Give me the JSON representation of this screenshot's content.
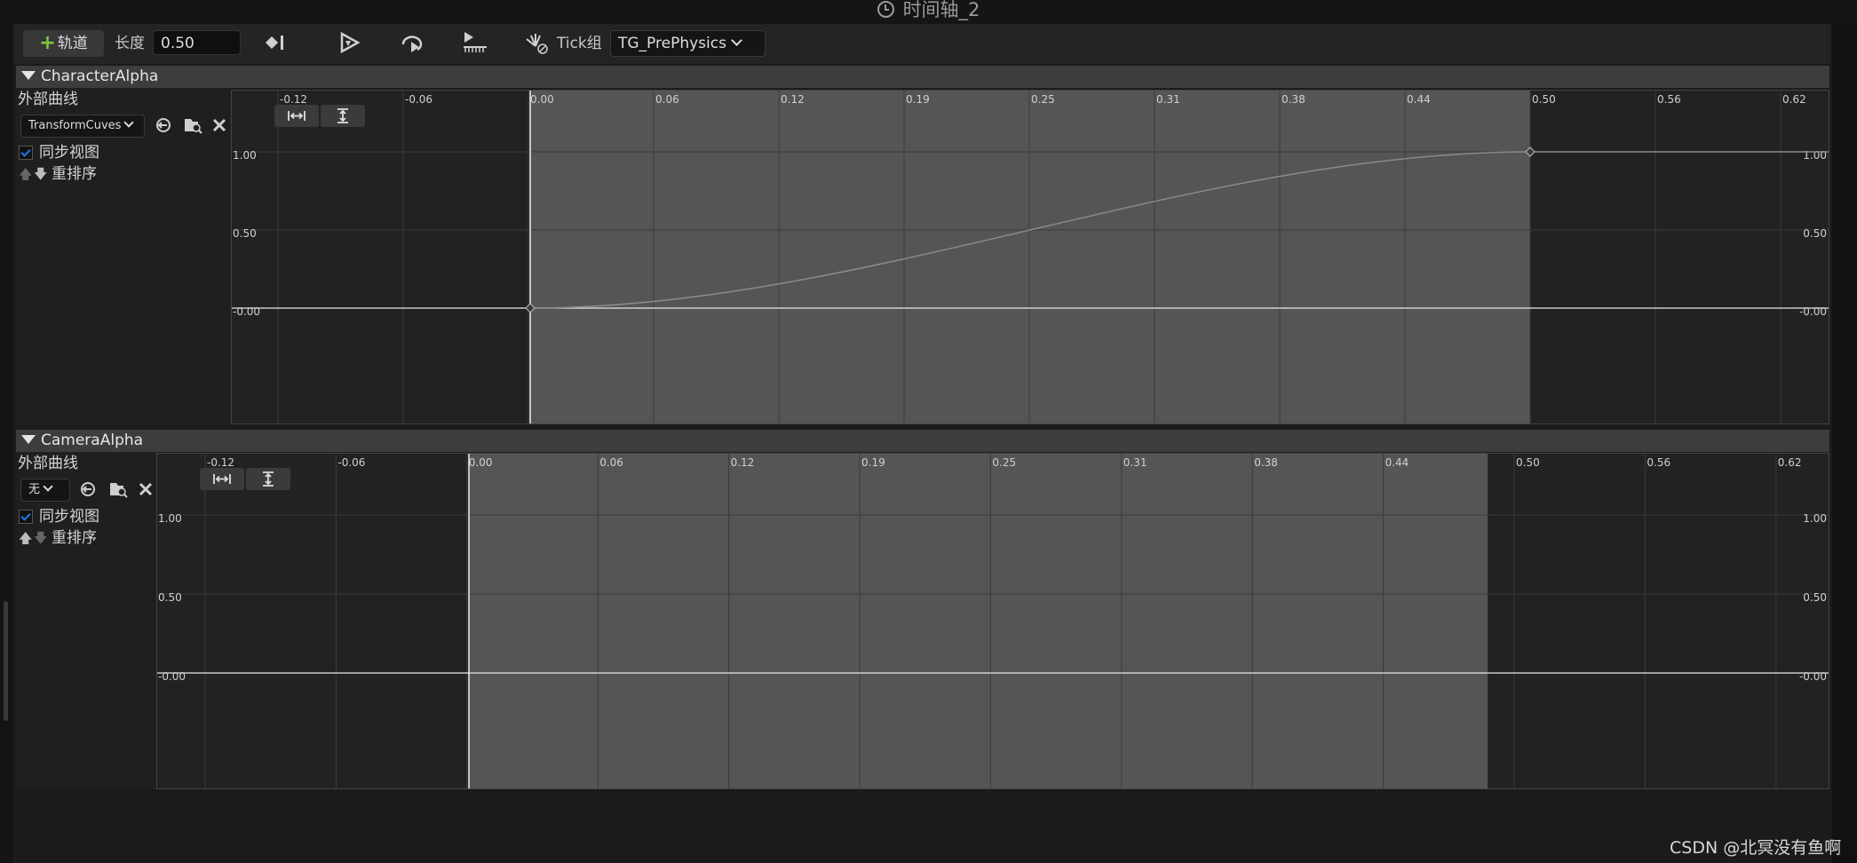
{
  "window": {
    "title": "时间轴_2"
  },
  "toolbar": {
    "add_track_label": "轨道",
    "length_label": "长度",
    "length_value": "0.50",
    "tick_group_label": "Tick组",
    "tick_group_value": "TG_PrePhysics",
    "icons": [
      "keyframe-icon",
      "autoplay-icon",
      "loop-icon",
      "use-last-keyframe-icon",
      "replicated-icon"
    ]
  },
  "tracks": [
    {
      "name": "CharacterAlpha",
      "external_curve_label": "外部曲线",
      "curve_asset": "TransformCuves",
      "sync_view_label": "同步视图",
      "sync_view_checked": true,
      "reorder_label": "重排序",
      "time_ticks": [
        "-0.12",
        "-0.06",
        "0.00",
        "0.06",
        "0.12",
        "0.19",
        "0.25",
        "0.31",
        "0.38",
        "0.44",
        "0.50",
        "0.56",
        "0.62"
      ],
      "value_ticks_left": [
        "1.00",
        "0.50",
        "-0.00"
      ],
      "value_ticks_right": [
        "1.00",
        "0.50",
        "-0.00"
      ],
      "keys": [
        {
          "time": 0.0,
          "value": 0.0
        },
        {
          "time": 0.5,
          "value": 1.0
        }
      ]
    },
    {
      "name": "CameraAlpha",
      "external_curve_label": "外部曲线",
      "curve_asset": "无",
      "sync_view_label": "同步视图",
      "sync_view_checked": true,
      "reorder_label": "重排序",
      "time_ticks": [
        "-0.12",
        "-0.06",
        "0.00",
        "0.06",
        "0.12",
        "0.19",
        "0.25",
        "0.31",
        "0.38",
        "0.44",
        "0.50",
        "0.56",
        "0.62"
      ],
      "value_ticks_left": [
        "1.00",
        "0.50",
        "-0.00"
      ],
      "value_ticks_right": [
        "1.00",
        "0.50",
        "-0.00"
      ],
      "keys": []
    }
  ],
  "watermark": "CSDN @北冥没有鱼啊"
}
